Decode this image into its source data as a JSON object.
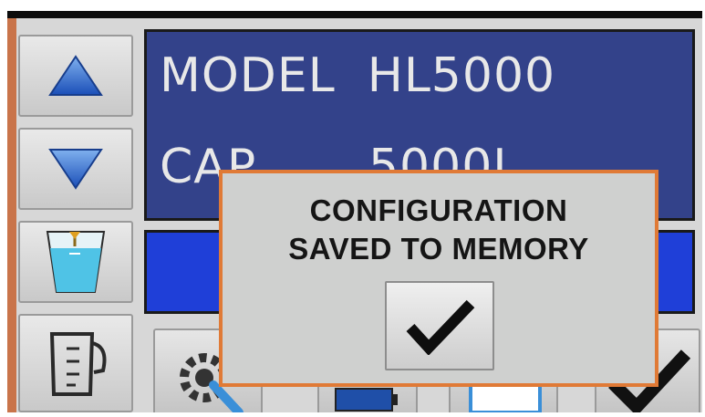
{
  "display": {
    "line1": "MODEL  HL5000",
    "line2": "CAP       5000L"
  },
  "dialog": {
    "line1": "CONFIGURATION",
    "line2": "SAVED TO MEMORY",
    "confirm_icon": "checkmark-icon"
  },
  "side_buttons": [
    "arrow-up-icon",
    "arrow-down-icon",
    "tank-level-icon",
    "measuring-jug-icon"
  ],
  "bottom_buttons": [
    "settings-wrench-icon",
    "battery-icon",
    "tank-icon",
    "checkmark-icon"
  ],
  "colors": {
    "display_bg": "#33428a",
    "blue_bar": "#1f3fd8",
    "dialog_border": "#e07a36",
    "dialog_bg": "#cfd0cf"
  }
}
